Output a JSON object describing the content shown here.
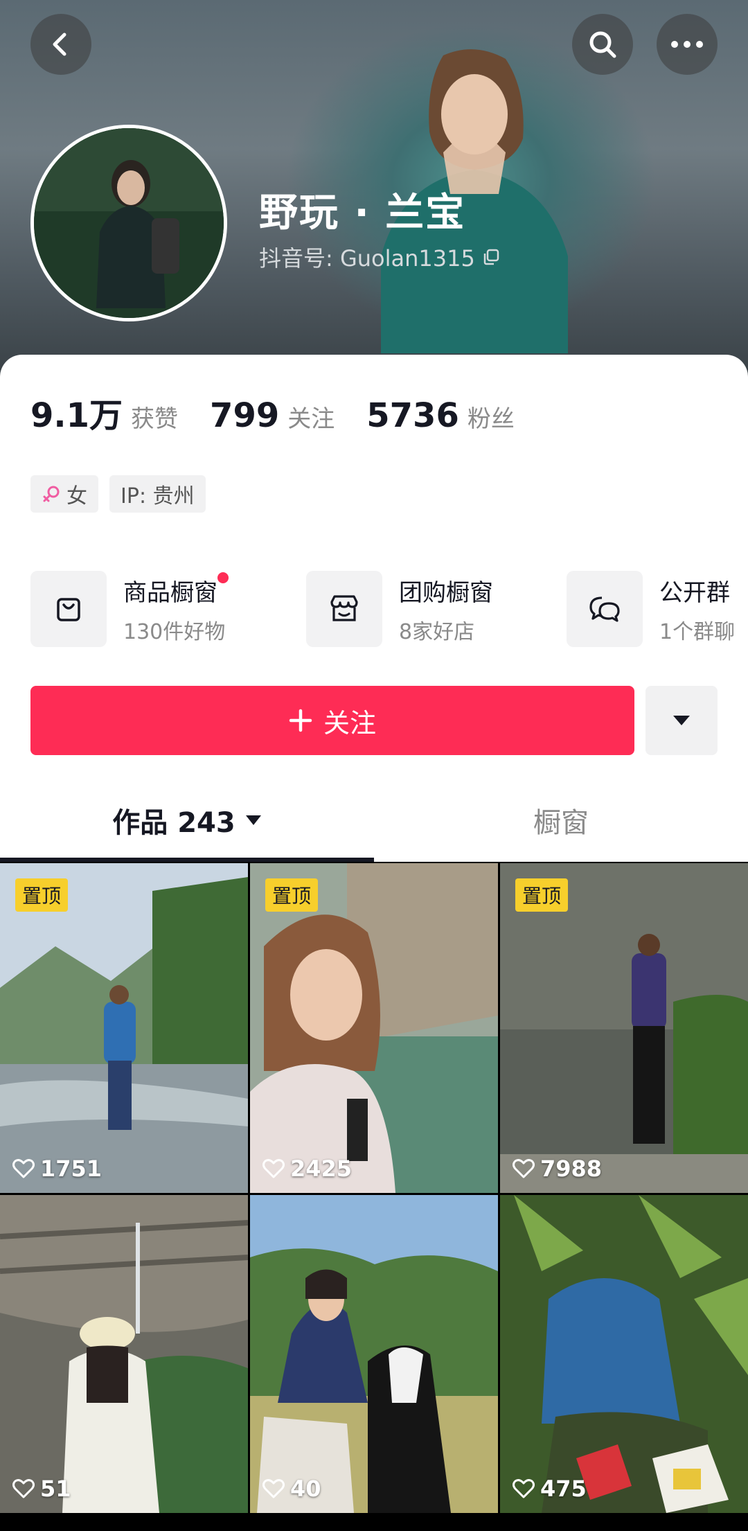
{
  "profile": {
    "name": "野玩 · 兰宝",
    "douyin_id": "抖音号: Guolan1315"
  },
  "stats": [
    {
      "value": "9.1万",
      "label": "获赞"
    },
    {
      "value": "799",
      "label": "关注"
    },
    {
      "value": "5736",
      "label": "粉丝"
    }
  ],
  "tags": {
    "gender": "女",
    "ip": "IP: 贵州"
  },
  "shortcuts": [
    {
      "title": "商品橱窗",
      "subtitle": "130件好物",
      "icon": "shopping-bag-icon"
    },
    {
      "title": "团购橱窗",
      "subtitle": "8家好店",
      "icon": "store-icon"
    },
    {
      "title": "公开群",
      "subtitle": "1个群聊",
      "icon": "chat-bubbles-icon"
    }
  ],
  "follow_button": "关注",
  "tabs": {
    "works": "作品 243",
    "showcase": "橱窗"
  },
  "videos": [
    {
      "pinned": "置顶",
      "likes": "1751"
    },
    {
      "pinned": "置顶",
      "likes": "2425"
    },
    {
      "pinned": "置顶",
      "likes": "7988"
    },
    {
      "pinned": "",
      "likes": "51"
    },
    {
      "pinned": "",
      "likes": "40"
    },
    {
      "pinned": "",
      "likes": "475"
    }
  ],
  "colors": {
    "accent": "#fe2c55",
    "pin_badge": "#f7cf2c"
  }
}
